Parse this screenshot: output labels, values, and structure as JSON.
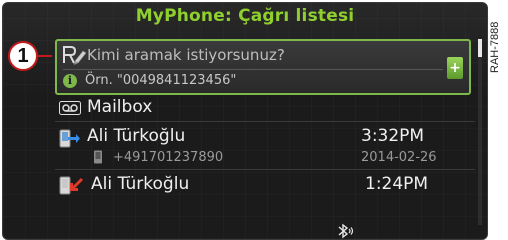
{
  "app": {
    "title": "MyPhone: Çağrı listesi"
  },
  "callout": {
    "number": "1"
  },
  "search": {
    "placeholder": "Kimi aramak istiyorsunuz?",
    "hint": "Örn. \"0049841123456\"",
    "add_label": "+"
  },
  "mailbox": {
    "label": "Mailbox"
  },
  "calls": [
    {
      "type": "outgoing",
      "name": "Ali Türkoğlu",
      "number": "+491701237890",
      "time": "3:32PM",
      "date": "2014-02-26"
    },
    {
      "type": "missed",
      "name": "Ali Türkoğlu",
      "time": "1:24PM"
    }
  ],
  "side_label": "RAH-7888",
  "colors": {
    "accent": "#8fd02f",
    "panel_border": "#7fb84a",
    "callout": "#c41a1a"
  },
  "icons": {
    "status": "bluetooth-icon"
  }
}
